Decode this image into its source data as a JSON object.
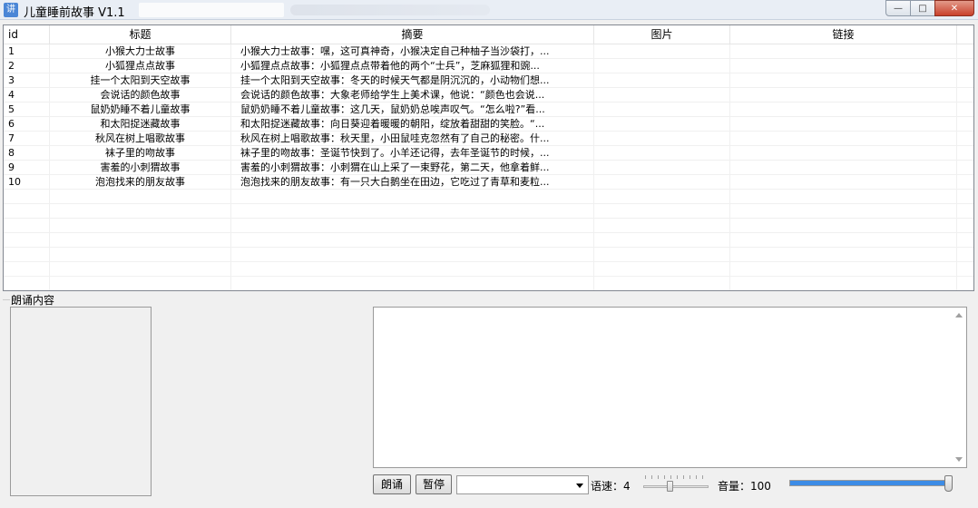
{
  "window": {
    "title": "儿童睡前故事 V1.1",
    "icon": "app-icon",
    "controls": [
      "minimize-icon",
      "maximize-icon",
      "close-icon"
    ]
  },
  "table": {
    "columns": [
      "id",
      "标题",
      "摘要",
      "图片",
      "链接"
    ],
    "rows": [
      {
        "id": "1",
        "title": "小猴大力士故事",
        "summary": "小猴大力士故事：嘿，这可真神奇，小猴决定自己种柚子当沙袋打，..."
      },
      {
        "id": "2",
        "title": "小狐狸点点故事",
        "summary": "小狐狸点点故事：小狐狸点点带着他的两个“士兵”，芝麻狐狸和豌..."
      },
      {
        "id": "3",
        "title": "挂一个太阳到天空故事",
        "summary": "挂一个太阳到天空故事：冬天的时候天气都是阴沉沉的，小动物们想..."
      },
      {
        "id": "4",
        "title": "会说话的颜色故事",
        "summary": "会说话的颜色故事：大象老师给学生上美术课，他说：“颜色也会说..."
      },
      {
        "id": "5",
        "title": "鼠奶奶睡不着儿童故事",
        "summary": "鼠奶奶睡不着儿童故事：这几天，鼠奶奶总唉声叹气。“怎么啦?”看..."
      },
      {
        "id": "6",
        "title": "和太阳捉迷藏故事",
        "summary": "和太阳捉迷藏故事：向日葵迎着暖暖的朝阳，绽放着甜甜的笑脸。“..."
      },
      {
        "id": "7",
        "title": "秋风在树上唱歌故事",
        "summary": "秋风在树上唱歌故事：秋天里，小田鼠哇克忽然有了自己的秘密。什..."
      },
      {
        "id": "8",
        "title": "袜子里的吻故事",
        "summary": "袜子里的吻故事：圣诞节快到了。小羊还记得，去年圣诞节的时候，..."
      },
      {
        "id": "9",
        "title": "害羞的小刺猬故事",
        "summary": "害羞的小刺猬故事：小刺猬在山上采了一束野花，第二天，他拿着鲜..."
      },
      {
        "id": "10",
        "title": "泡泡找来的朋友故事",
        "summary": "泡泡找来的朋友故事：有一只大白鹅坐在田边，它吃过了青草和麦粒..."
      }
    ]
  },
  "reading": {
    "group_label": "朗诵内容",
    "read_button": "朗诵",
    "pause_button": "暂停",
    "voice_selected": "",
    "speed_label": "语速：",
    "speed_value": "4",
    "speed_min": 0,
    "speed_max": 10,
    "volume_label": "音量：",
    "volume_value": "100",
    "volume_fraction": 1.0,
    "accent_color": "#3c8ce6"
  }
}
